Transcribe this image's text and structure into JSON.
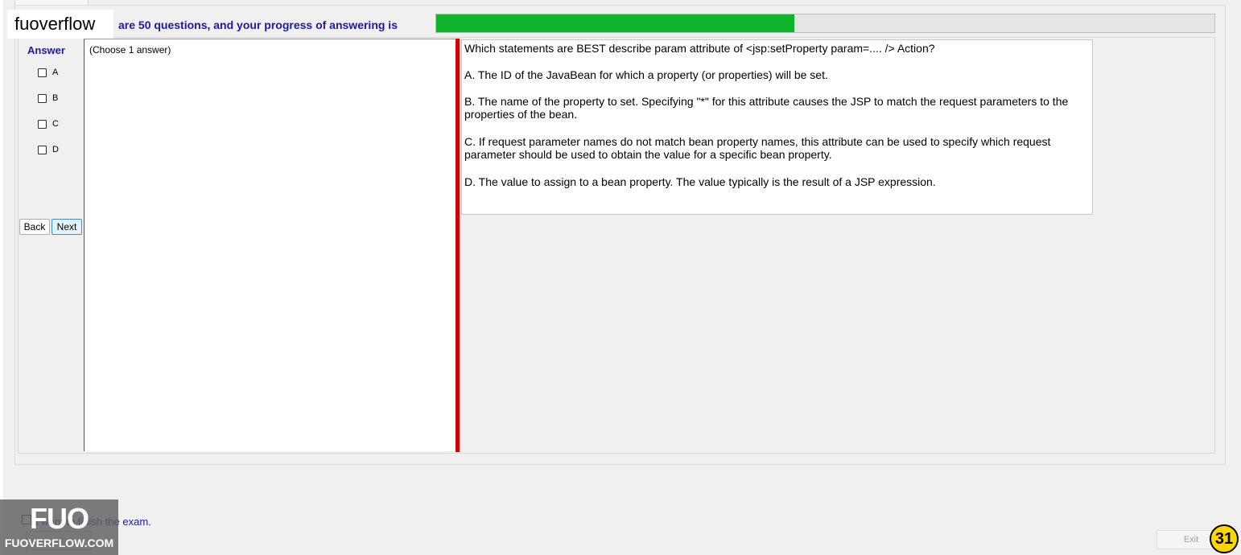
{
  "brand": "fuoverflow",
  "header": {
    "progress_text": "are 50 questions, and your progress of answering is",
    "progress": 0.46
  },
  "answer": {
    "label": "Answer",
    "options": [
      "A",
      "B",
      "C",
      "D"
    ]
  },
  "nav": {
    "back_label": "Back",
    "next_label": "Next"
  },
  "choose_text": "(Choose 1 answer)",
  "question": {
    "title": "Which statements are BEST describe param attribute of <jsp:setProperty param=.... /> Action?",
    "a": "A.  The ID of the JavaBean for which a property (or properties) will be set.",
    "b": "B.  The name of the property to set. Specifying \"*\" for this attribute causes the JSP to match the request parameters to the properties of the bean.",
    "c": "C.  If request parameter names do not match bean property names, this attribute can be used to specify which request parameter should be used to obtain the value for a specific bean property.",
    "d": "D.  The value to assign to a bean property. The value typically is the result of a JSP expression."
  },
  "finish": {
    "text": "I want to finish the exam."
  },
  "watermark": {
    "logo": "FUO",
    "text": "FUOVERFLOW.COM"
  },
  "exit_label": "Exit",
  "page_badge": "31",
  "colors": {
    "progress_fill": "#10b42a",
    "divider": "#d40000",
    "label_blue": "#1a1aa6"
  }
}
